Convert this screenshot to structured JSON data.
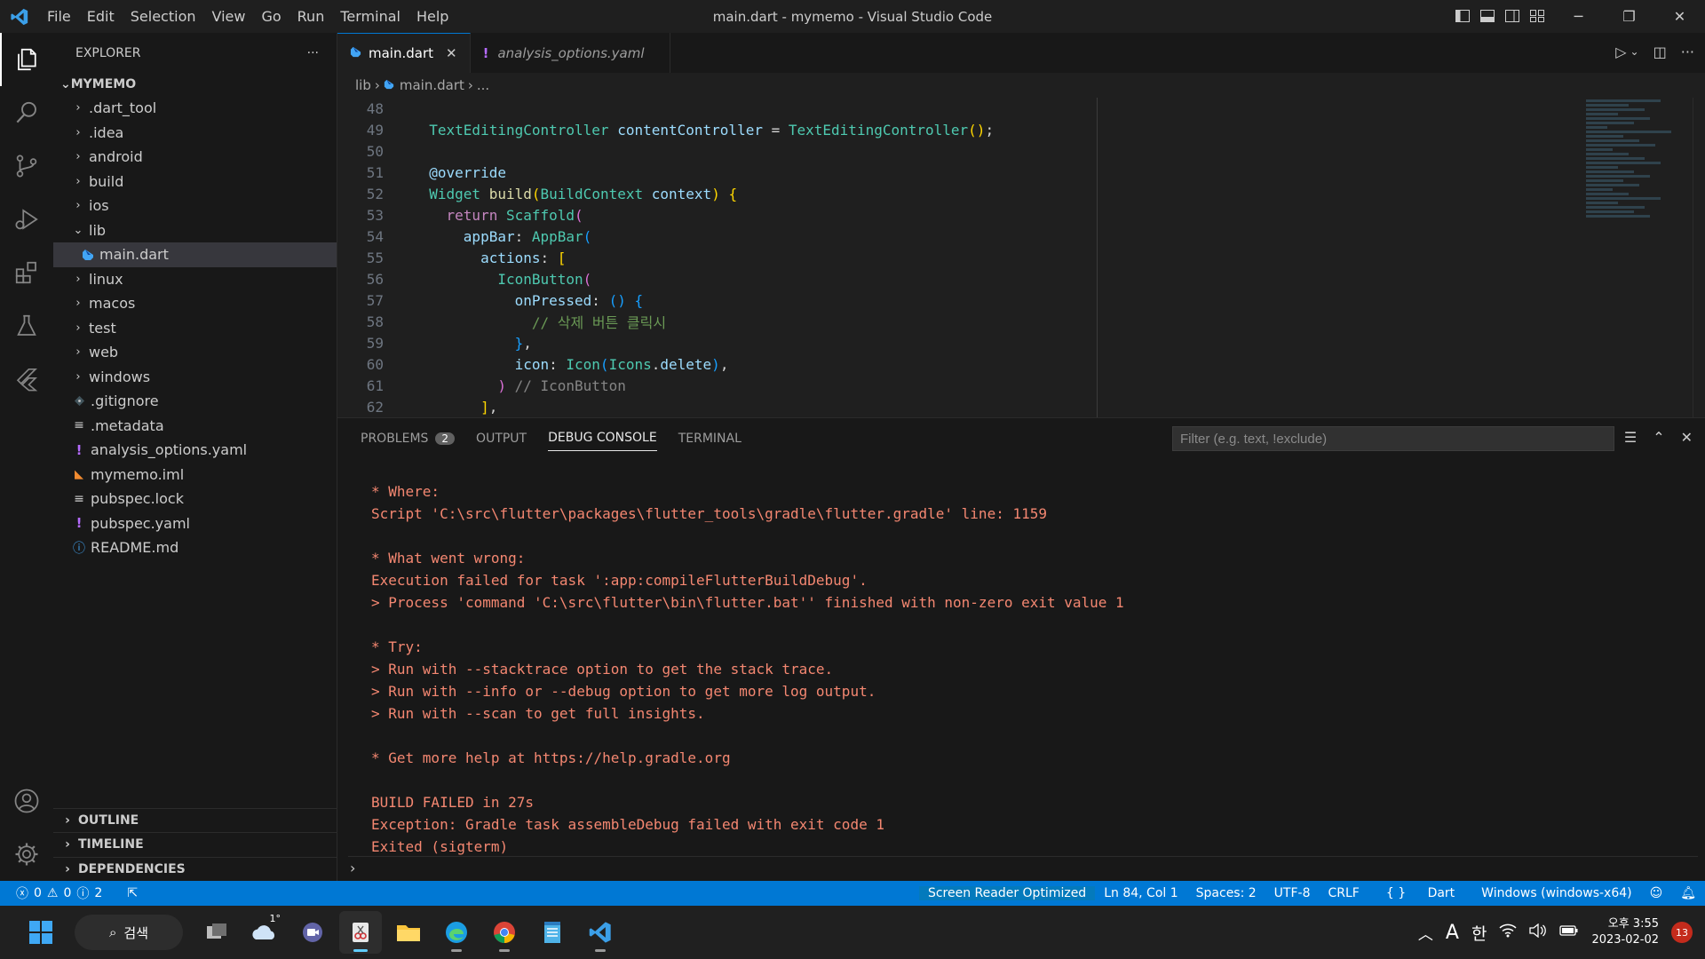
{
  "window": {
    "title": "main.dart - mymemo - Visual Studio Code",
    "menu": [
      "File",
      "Edit",
      "Selection",
      "View",
      "Go",
      "Run",
      "Terminal",
      "Help"
    ]
  },
  "sidebar": {
    "header": "EXPLORER",
    "project": "MYMEMO",
    "items": [
      {
        "label": ".dart_tool",
        "type": "folder",
        "depth": 1,
        "expanded": false
      },
      {
        "label": ".idea",
        "type": "folder",
        "depth": 1,
        "expanded": false
      },
      {
        "label": "android",
        "type": "folder",
        "depth": 1,
        "expanded": false
      },
      {
        "label": "build",
        "type": "folder",
        "depth": 1,
        "expanded": false
      },
      {
        "label": "ios",
        "type": "folder",
        "depth": 1,
        "expanded": false
      },
      {
        "label": "lib",
        "type": "folder",
        "depth": 1,
        "expanded": true
      },
      {
        "label": "main.dart",
        "type": "dart",
        "depth": 2,
        "selected": true
      },
      {
        "label": "linux",
        "type": "folder",
        "depth": 1,
        "expanded": false
      },
      {
        "label": "macos",
        "type": "folder",
        "depth": 1,
        "expanded": false
      },
      {
        "label": "test",
        "type": "folder",
        "depth": 1,
        "expanded": false
      },
      {
        "label": "web",
        "type": "folder",
        "depth": 1,
        "expanded": false
      },
      {
        "label": "windows",
        "type": "folder",
        "depth": 1,
        "expanded": false
      },
      {
        "label": ".gitignore",
        "type": "git",
        "depth": 1
      },
      {
        "label": ".metadata",
        "type": "lines",
        "depth": 1
      },
      {
        "label": "analysis_options.yaml",
        "type": "yaml",
        "depth": 1
      },
      {
        "label": "mymemo.iml",
        "type": "rss",
        "depth": 1
      },
      {
        "label": "pubspec.lock",
        "type": "lines",
        "depth": 1
      },
      {
        "label": "pubspec.yaml",
        "type": "yaml",
        "depth": 1
      },
      {
        "label": "README.md",
        "type": "info",
        "depth": 1
      }
    ],
    "sections": [
      "OUTLINE",
      "TIMELINE",
      "DEPENDENCIES"
    ]
  },
  "tabs": [
    {
      "label": "main.dart",
      "active": true,
      "icon": "dart-icon"
    },
    {
      "label": "analysis_options.yaml",
      "active": false,
      "icon": "yaml-icon"
    }
  ],
  "breadcrumb": [
    "lib",
    "main.dart",
    "..."
  ],
  "code": {
    "lines": [
      {
        "n": "48",
        "tokens": [
          [
            "",
            "    "
          ],
          [
            "t-dim",
            "                      "
          ]
        ]
      },
      {
        "n": "49",
        "tokens": [
          [
            "",
            "  "
          ],
          [
            "t-type",
            "TextEditingController"
          ],
          [
            "",
            " "
          ],
          [
            "t-var",
            "contentController"
          ],
          [
            "t-pun",
            " = "
          ],
          [
            "t-type",
            "TextEditingController"
          ],
          [
            "t-br1",
            "()"
          ],
          [
            "t-pun",
            ";"
          ]
        ]
      },
      {
        "n": "50",
        "tokens": []
      },
      {
        "n": "51",
        "tokens": [
          [
            "",
            "  "
          ],
          [
            "t-var",
            "@override"
          ]
        ]
      },
      {
        "n": "52",
        "tokens": [
          [
            "",
            "  "
          ],
          [
            "t-type",
            "Widget"
          ],
          [
            "",
            " "
          ],
          [
            "t-fn",
            "build"
          ],
          [
            "t-br1",
            "("
          ],
          [
            "t-type",
            "BuildContext"
          ],
          [
            "",
            " "
          ],
          [
            "t-var",
            "context"
          ],
          [
            "t-br1",
            ")"
          ],
          [
            "",
            " "
          ],
          [
            "t-br1",
            "{"
          ]
        ]
      },
      {
        "n": "53",
        "tokens": [
          [
            "",
            "    "
          ],
          [
            "t-kw",
            "return"
          ],
          [
            "",
            " "
          ],
          [
            "t-type",
            "Scaffold"
          ],
          [
            "t-br2",
            "("
          ]
        ]
      },
      {
        "n": "54",
        "tokens": [
          [
            "",
            "      "
          ],
          [
            "t-var",
            "appBar"
          ],
          [
            "t-pun",
            ": "
          ],
          [
            "t-type",
            "AppBar"
          ],
          [
            "t-br3",
            "("
          ]
        ]
      },
      {
        "n": "55",
        "tokens": [
          [
            "",
            "        "
          ],
          [
            "t-var",
            "actions"
          ],
          [
            "t-pun",
            ": "
          ],
          [
            "t-br1",
            "["
          ]
        ]
      },
      {
        "n": "56",
        "tokens": [
          [
            "",
            "          "
          ],
          [
            "t-type",
            "IconButton"
          ],
          [
            "t-br2",
            "("
          ]
        ]
      },
      {
        "n": "57",
        "tokens": [
          [
            "",
            "            "
          ],
          [
            "t-var",
            "onPressed"
          ],
          [
            "t-pun",
            ": "
          ],
          [
            "t-br3",
            "()"
          ],
          [
            "",
            " "
          ],
          [
            "t-br3",
            "{"
          ]
        ]
      },
      {
        "n": "58",
        "tokens": [
          [
            "",
            "              "
          ],
          [
            "t-cm",
            "// 삭제 버튼 클릭시"
          ]
        ]
      },
      {
        "n": "59",
        "tokens": [
          [
            "",
            "            "
          ],
          [
            "t-br3",
            "}"
          ],
          [
            "t-pun",
            ","
          ]
        ]
      },
      {
        "n": "60",
        "tokens": [
          [
            "",
            "            "
          ],
          [
            "t-var",
            "icon"
          ],
          [
            "t-pun",
            ": "
          ],
          [
            "t-type",
            "Icon"
          ],
          [
            "t-br3",
            "("
          ],
          [
            "t-type",
            "Icons"
          ],
          [
            "t-pun",
            "."
          ],
          [
            "t-var",
            "delete"
          ],
          [
            "t-br3",
            ")"
          ],
          [
            "t-pun",
            ","
          ]
        ]
      },
      {
        "n": "61",
        "tokens": [
          [
            "",
            "          "
          ],
          [
            "t-br2",
            ")"
          ],
          [
            "",
            " "
          ],
          [
            "t-dim",
            "// IconButton"
          ]
        ]
      },
      {
        "n": "62",
        "tokens": [
          [
            "",
            "        "
          ],
          [
            "t-br1",
            "]"
          ],
          [
            "t-pun",
            ","
          ]
        ]
      }
    ]
  },
  "panel": {
    "tabs": [
      {
        "label": "PROBLEMS",
        "badge": "2",
        "active": false
      },
      {
        "label": "OUTPUT",
        "active": false
      },
      {
        "label": "DEBUG CONSOLE",
        "active": true
      },
      {
        "label": "TERMINAL",
        "active": false
      }
    ],
    "filter_placeholder": "Filter (e.g. text, !exclude)",
    "console_lines": [
      "* Where:",
      "Script 'C:\\src\\flutter\\packages\\flutter_tools\\gradle\\flutter.gradle' line: 1159",
      "",
      "* What went wrong:",
      "Execution failed for task ':app:compileFlutterBuildDebug'.",
      "> Process 'command 'C:\\src\\flutter\\bin\\flutter.bat'' finished with non-zero exit value 1",
      "",
      "* Try:",
      "> Run with --stacktrace option to get the stack trace.",
      "> Run with --info or --debug option to get more log output.",
      "> Run with --scan to get full insights.",
      "",
      "* Get more help at https://help.gradle.org",
      "",
      "BUILD FAILED in 27s",
      "Exception: Gradle task assembleDebug failed with exit code 1",
      "Exited (sigterm)"
    ]
  },
  "statusbar": {
    "errors": "0",
    "warnings": "0",
    "infos": "2",
    "screen_reader": "Screen Reader Optimized",
    "position": "Ln 84, Col 1",
    "spaces": "Spaces: 2",
    "encoding": "UTF-8",
    "eol": "CRLF",
    "language": "Dart",
    "platform": "Windows (windows-x64)"
  },
  "taskbar": {
    "search_label": "검색",
    "weather": "1°",
    "clock_time": "오후 3:55",
    "clock_date": "2023-02-02",
    "notifications": "13",
    "ime_a": "A",
    "ime_lang": "한"
  },
  "colors": {
    "accent": "#0078d4",
    "error_text": "#f48771",
    "activity_bg": "#181818",
    "editor_bg": "#1f1f1f"
  }
}
